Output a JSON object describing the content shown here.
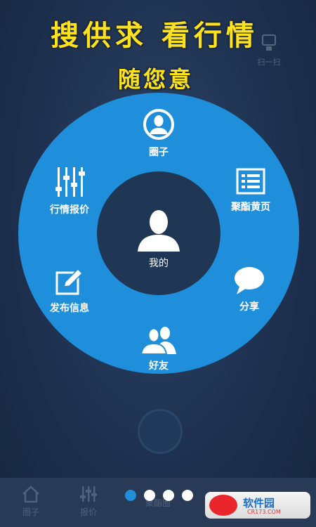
{
  "header": {
    "headline_1": "搜供求 看行情",
    "headline_2": "随您意",
    "scan_label": "扫一扫"
  },
  "menu": {
    "center_label": "我的",
    "items": [
      {
        "label": "圈子",
        "icon": "person-circle-icon"
      },
      {
        "label": "聚酯黄页",
        "icon": "directory-list-icon"
      },
      {
        "label": "分享",
        "icon": "speech-bubble-icon"
      },
      {
        "label": "好友",
        "icon": "friends-icon"
      },
      {
        "label": "发布信息",
        "icon": "edit-icon"
      },
      {
        "label": "行情报价",
        "icon": "sliders-icon"
      }
    ]
  },
  "bottom_nav": {
    "tabs": [
      {
        "label": "圈子"
      },
      {
        "label": "报价"
      },
      {
        "label": "聚酯圈"
      }
    ]
  },
  "pager": {
    "total": 4,
    "active": 1
  },
  "watermark": {
    "text": "软件园",
    "sub": "CR173.COM"
  },
  "colors": {
    "ring": "#1f8fdb",
    "headline": "#ffe21a",
    "background": "#1e3150"
  }
}
